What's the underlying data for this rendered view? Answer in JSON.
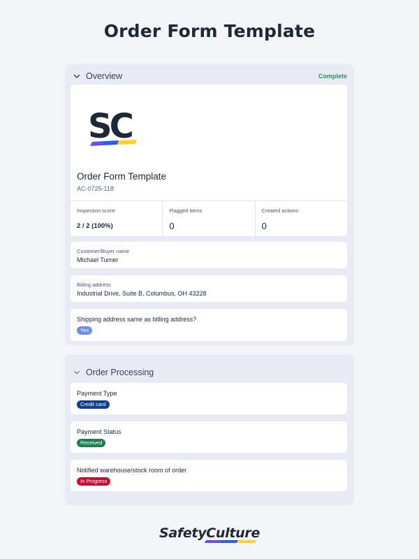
{
  "page": {
    "title": "Order Form Template"
  },
  "overview": {
    "section_title": "Overview",
    "status": "Complete",
    "logo_text": "SC",
    "doc_title": "Order Form Template",
    "doc_id": "AC-0725-118",
    "stats": [
      {
        "label": "Inspection score",
        "value": "2 / 2 (100%)"
      },
      {
        "label": "Flagged items",
        "value": "0"
      },
      {
        "label": "Created actions",
        "value": "0"
      }
    ],
    "customer": {
      "label": "Customer/Buyer name",
      "value": "Michael Turner"
    },
    "billing": {
      "label": "Billing address",
      "value": "Industrial Drive, Suite B, Columbus, OH 43228"
    },
    "shipping": {
      "question": "Shipping address same as billing address?",
      "answer": "Yes"
    }
  },
  "processing": {
    "section_title": "Order Processing",
    "items": [
      {
        "question": "Payment Type",
        "answer": "Credit card"
      },
      {
        "question": "Payment Status",
        "answer": "Received"
      },
      {
        "question": "Notified warehouse/stock room of order",
        "answer": "In Progress"
      }
    ]
  },
  "colors": {
    "yes": "#6f8fe6",
    "credit_card": "#123f91",
    "received": "#1f7f52",
    "in_progress": "#c8102e",
    "complete": "#2f8f67"
  },
  "footer": {
    "brand": "SafetyCulture"
  }
}
